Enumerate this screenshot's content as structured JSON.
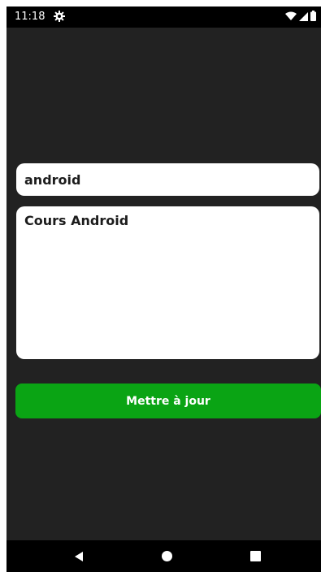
{
  "status_bar": {
    "time": "11:18",
    "icons": [
      "settings-gear-icon",
      "wifi-icon",
      "signal-icon",
      "battery-icon"
    ]
  },
  "form": {
    "title_value": "android",
    "content_value": "Cours Android",
    "update_label": "Mettre à jour"
  },
  "nav_bar": {
    "buttons": [
      "back-icon",
      "home-icon",
      "recents-icon"
    ]
  },
  "colors": {
    "background": "#222222",
    "button": "#0aa414",
    "field": "#ffffff"
  }
}
